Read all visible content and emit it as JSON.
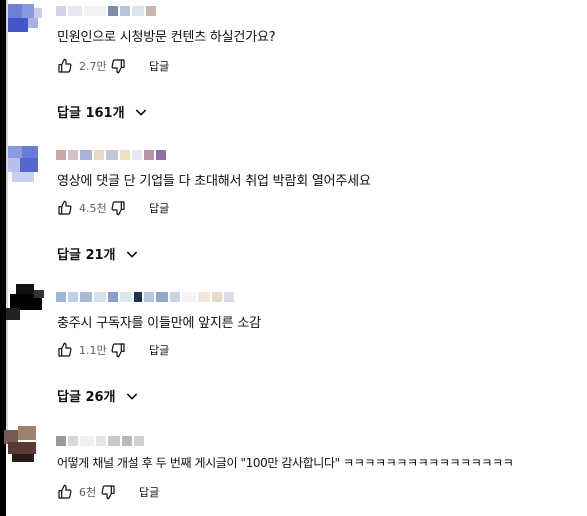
{
  "comments": [
    {
      "text": "민원인으로 시청방문 컨텐츠 하실건가요?",
      "likes": "2.7만",
      "reply_label": "답글",
      "replies_toggle": "답글 161개"
    },
    {
      "text": "영상에 댓글 단 기업들 다 초대해서 취업 박람회 열어주세요",
      "likes": "4.5천",
      "reply_label": "답글",
      "replies_toggle": "답글 21개"
    },
    {
      "text": "충주시 구독자를 이들만에 앞지른 소감",
      "likes": "1.1만",
      "reply_label": "답글",
      "replies_toggle": "답글 26개"
    },
    {
      "text": "어떻게 채널 개설 후 두 번째 게시글이 \"100만 감사합니다\" ㅋㅋㅋㅋㅋㅋㅋㅋㅋㅋㅋㅋㅋㅋㅋㅋ",
      "likes": "6천",
      "reply_label": "답글"
    }
  ],
  "icons": {
    "like": "thumbs-up-icon",
    "dislike": "thumbs-down-icon",
    "expand": "chevron-down-icon"
  }
}
